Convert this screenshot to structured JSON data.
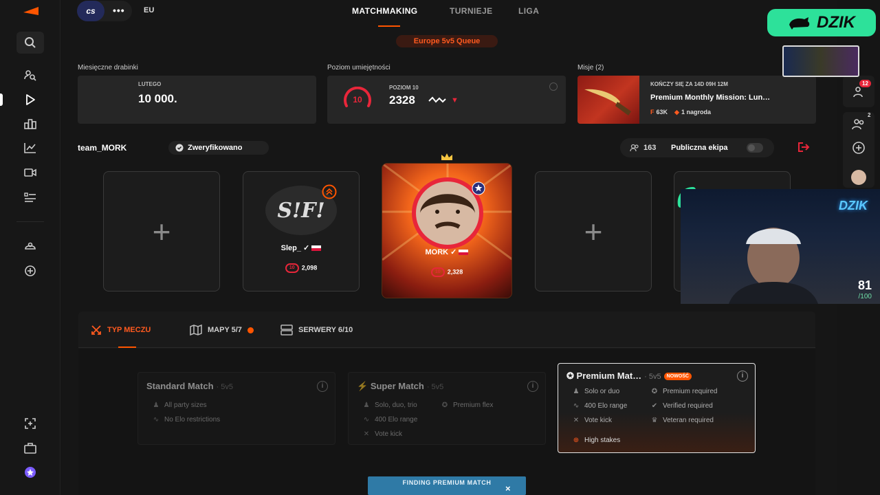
{
  "colors": {
    "accent": "#ff5500",
    "elo_red": "#e8263a",
    "stream_green": "#2de19a",
    "finding_blue": "#2f7aa6"
  },
  "left_sidebar": {
    "icons": [
      "logo-icon",
      "search-icon",
      "find-players-icon",
      "play-icon",
      "leaderboard-icon",
      "stats-icon",
      "video-icon",
      "list-icon",
      "club-icon",
      "add-circle-icon",
      "capture-icon",
      "briefcase-icon",
      "premium-star-icon"
    ]
  },
  "topbar": {
    "game_logo": "cs",
    "game_menu": "•••",
    "region": "EU",
    "tabs": [
      {
        "label": "MATCHMAKING",
        "active": true
      },
      {
        "label": "TURNIEJE",
        "active": false
      },
      {
        "label": "LIGA",
        "active": false
      }
    ],
    "queue_badge": "Europe 5v5 Queue"
  },
  "stats": {
    "ladder": {
      "label": "Miesięczne drabinki",
      "month": "LUTEGO",
      "value": "10 000."
    },
    "skill": {
      "label": "Poziom umiejętności",
      "level_label": "POZIOM 10",
      "level": "10",
      "elo": "2328"
    },
    "missions": {
      "label": "Misje (2)",
      "ends": "KOŃCZY SIĘ ZA 14D 09H 12M",
      "title": "Premium Monthly Mission: Lun…",
      "points": "63K",
      "reward": "1 nagroda"
    }
  },
  "team": {
    "name": "team_MORK",
    "verified": "Zweryfikowano",
    "count": "163",
    "public_label": "Publiczna ekipa",
    "public_enabled": false
  },
  "slots": [
    {
      "type": "empty",
      "plus": "+"
    },
    {
      "type": "player",
      "name": "Slep_",
      "level": "10",
      "elo": "2,098"
    },
    {
      "type": "captain",
      "name": "MORK",
      "level": "10",
      "elo": "2,328"
    },
    {
      "type": "empty",
      "plus": "+"
    },
    {
      "type": "empty",
      "plus": "+"
    }
  ],
  "match_panel": {
    "tabs": [
      {
        "label": "TYP MECZU",
        "active": true
      },
      {
        "label": "MAPY 5/7",
        "active": false
      },
      {
        "label": "SERWERY 6/10",
        "active": false
      }
    ],
    "modes": [
      {
        "title": "Standard Match",
        "sub": "· 5v5",
        "selected": false,
        "features": [
          "All party sizes",
          "No Elo restrictions"
        ]
      },
      {
        "title": "Super Match",
        "sub": "· 5v5",
        "selected": false,
        "features": [
          "Solo, duo, trio",
          "Premium flex",
          "400 Elo range",
          "Vote kick"
        ]
      },
      {
        "title": "Premium Mat…",
        "sub": "· 5v5",
        "new_badge": "NOWOŚĆ",
        "selected": true,
        "features": [
          "Solo or duo",
          "Premium required",
          "400 Elo range",
          "Verified required",
          "Vote kick",
          "Veteran required",
          "High stakes"
        ]
      }
    ],
    "finding": "FINDING PREMIUM MATCH",
    "finding_close": "×"
  },
  "right_sidebar": {
    "notif_count": "12",
    "friends_count": "2"
  },
  "stream_overlay": {
    "brand": "DZIK",
    "cam_sign": "DZIK",
    "score": "81",
    "score_total": "/100"
  }
}
